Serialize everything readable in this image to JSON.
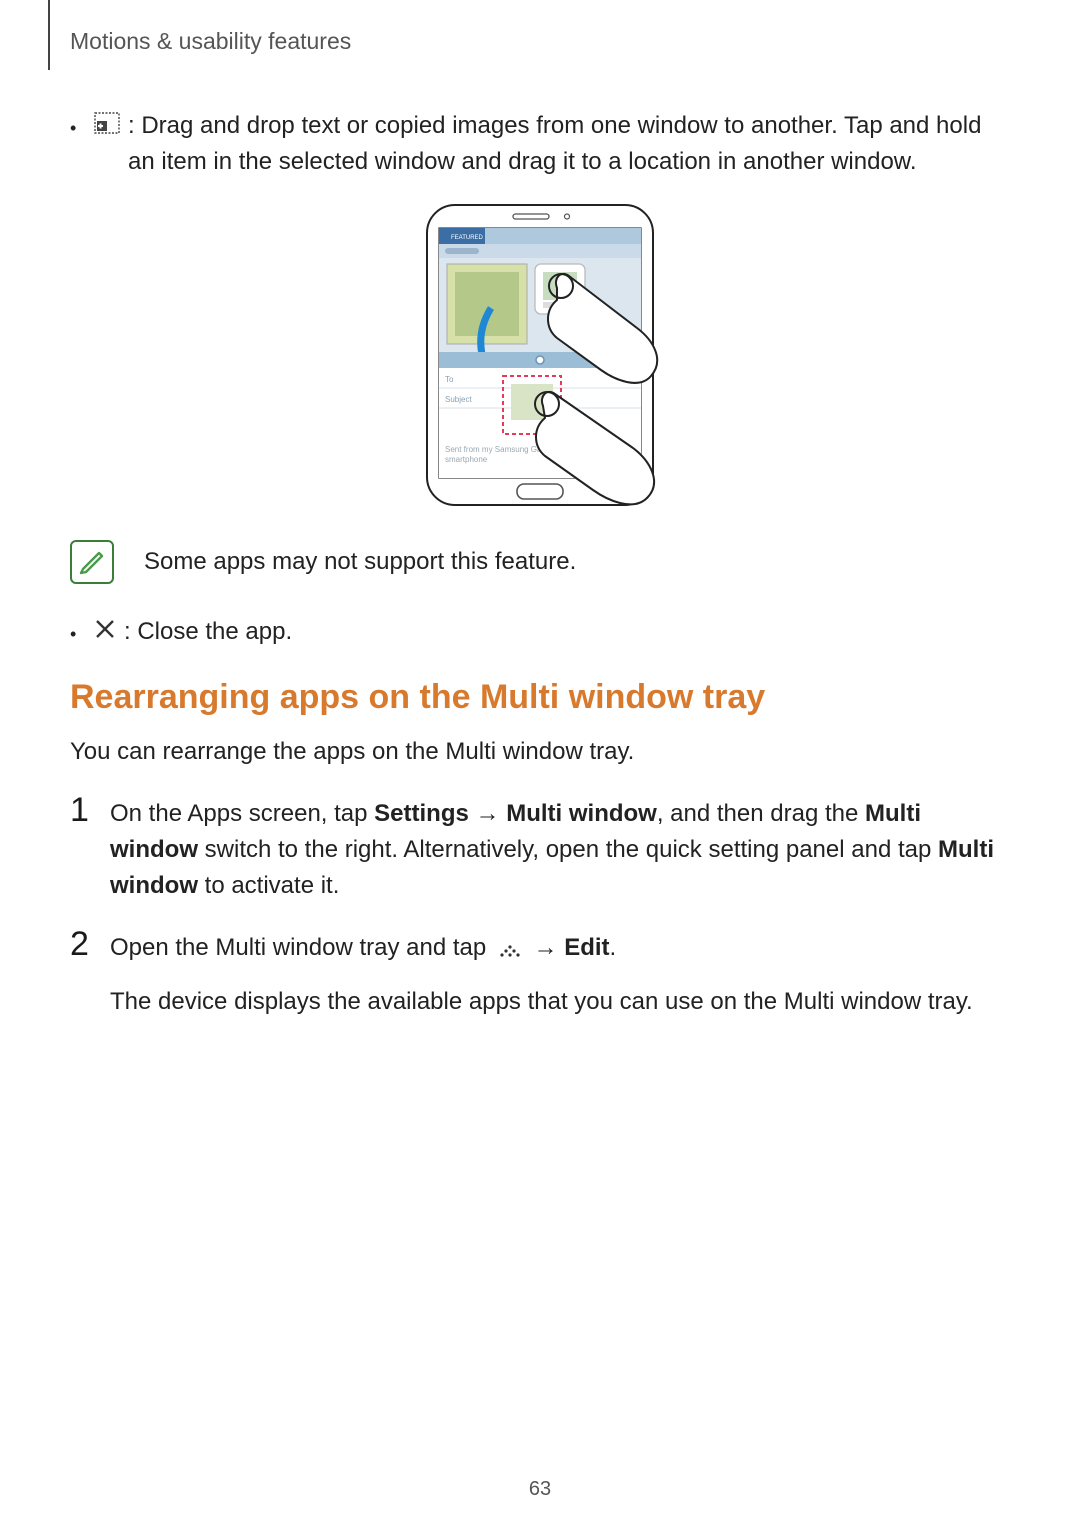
{
  "header": {
    "section_title": "Motions & usability features"
  },
  "bullets": {
    "drag_drop": {
      "icon_name": "drag-content-icon",
      "text_before": " : Drag and drop text or copied images from one window to another. Tap and hold an item in the selected window and drag it to a location in another window."
    },
    "close": {
      "icon_name": "close-x-icon",
      "text": " : Close the app."
    }
  },
  "note": {
    "text": "Some apps may not support this feature."
  },
  "heading": "Rearranging apps on the Multi window tray",
  "intro": "You can rearrange the apps on the Multi window tray.",
  "steps": [
    {
      "num": "1",
      "parts": {
        "a": "On the Apps screen, tap ",
        "settings": "Settings",
        "arrow1": " → ",
        "mw1": "Multi window",
        "b": ", and then drag the ",
        "mw2": "Multi window",
        "c": " switch to the right. Alternatively, open the quick setting panel and tap ",
        "mw3": "Multi window",
        "d": " to activate it."
      }
    },
    {
      "num": "2",
      "parts": {
        "a": "Open the Multi window tray and tap ",
        "more_icon": "more-dots-icon",
        "arrow": " → ",
        "edit": "Edit",
        "period": "."
      },
      "sub": "The device displays the available apps that you can use on the Multi window tray."
    }
  ],
  "illustration": {
    "footer_text": "Sent from my Samsung Galaxy smartphone",
    "labels": {
      "to": "To",
      "subject": "Subject"
    }
  },
  "page_number": "63"
}
